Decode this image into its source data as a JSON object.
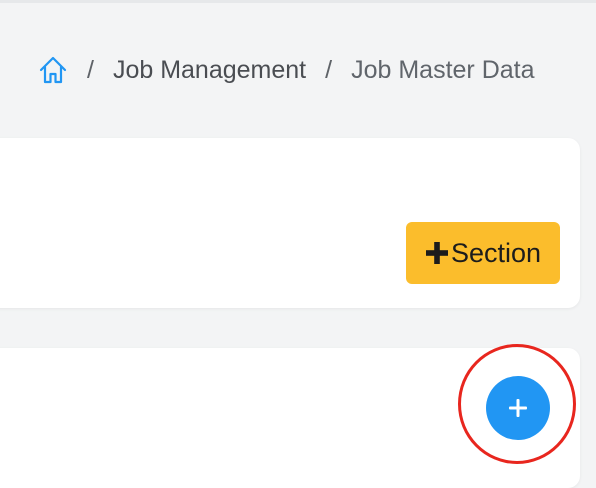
{
  "breadcrumb": {
    "home_icon": "home-icon",
    "separator": "/",
    "items": [
      {
        "label": "Job Management"
      },
      {
        "label": "Job Master Data"
      }
    ]
  },
  "section_button": {
    "icon": "plus-icon",
    "label": "Section"
  },
  "fab": {
    "icon": "plus-icon"
  },
  "colors": {
    "background": "#f3f4f5",
    "card": "#ffffff",
    "accent_yellow": "#fbbd2c",
    "accent_blue": "#2196f3",
    "highlight_red": "#e8261e",
    "home_icon": "#2196f3"
  }
}
